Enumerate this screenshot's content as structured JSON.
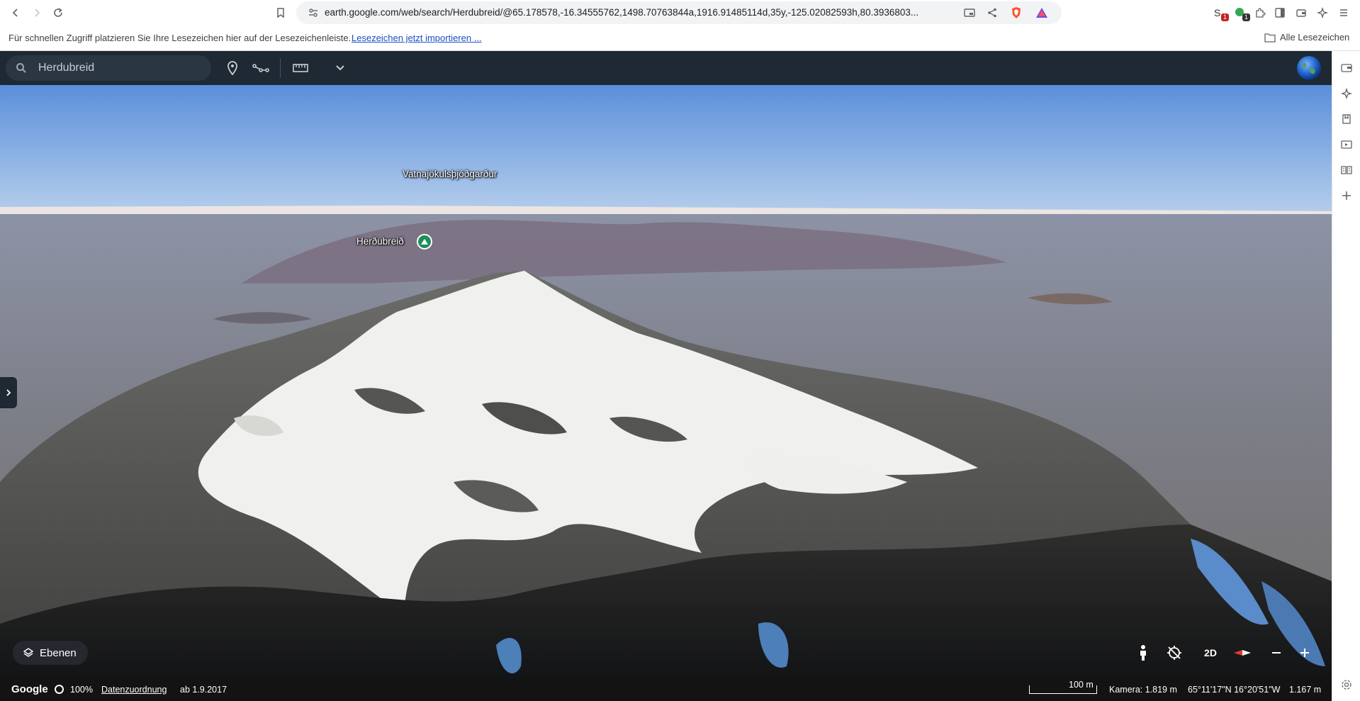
{
  "browser": {
    "url": "earth.google.com/web/search/Herdubreid/@65.178578,-16.34555762,1498.70763844a,1916.91485114d,35y,-125.02082593h,80.3936803...",
    "bookmarks_hint": "Für schnellen Zugriff platzieren Sie Ihre Lesezeichen hier auf der Lesezeichenleiste.",
    "bookmarks_import_link": "Lesezeichen jetzt importieren ...",
    "all_bookmarks": "Alle Lesezeichen",
    "ext_badge_1": "1",
    "ext_badge_2": "1"
  },
  "earth": {
    "search": {
      "value": "Herdubreid"
    },
    "places": {
      "park_label": "Vatnajökulsþjóðgarður",
      "mountain_label": "Herðubreið"
    },
    "controls": {
      "layers_label": "Ebenen",
      "mode_2d": "2D"
    },
    "status": {
      "logo": "Google",
      "loading": "100%",
      "attribution": "Datenzuordnung",
      "imagery_date": "ab 1.9.2017",
      "scale": "100 m",
      "camera": "Kamera: 1.819 m",
      "coords": "65°11'17\"N 16°20'51\"W",
      "elevation": "1.167 m"
    }
  },
  "colors": {
    "header_bg": "#1f2933",
    "sky_top": "#5b8fdb",
    "sky_horizon": "#d8e3ef",
    "snow": "#f0f0ee",
    "rock": "#5a5a58",
    "place_pin": "#1e8e5a"
  },
  "icons": {
    "back": "arrow-left-icon",
    "forward": "arrow-right-icon",
    "reload": "reload-icon",
    "bookmark": "bookmark-icon",
    "search": "search-icon",
    "pin": "map-pin-icon",
    "path": "path-icon",
    "ruler": "ruler-icon",
    "more": "chevron-down-icon",
    "globe": "globe-icon",
    "layers": "layers-icon",
    "pegman": "pegman-icon",
    "compass": "compass-icon",
    "zoom_out": "minus-icon",
    "zoom_in": "plus-icon"
  }
}
